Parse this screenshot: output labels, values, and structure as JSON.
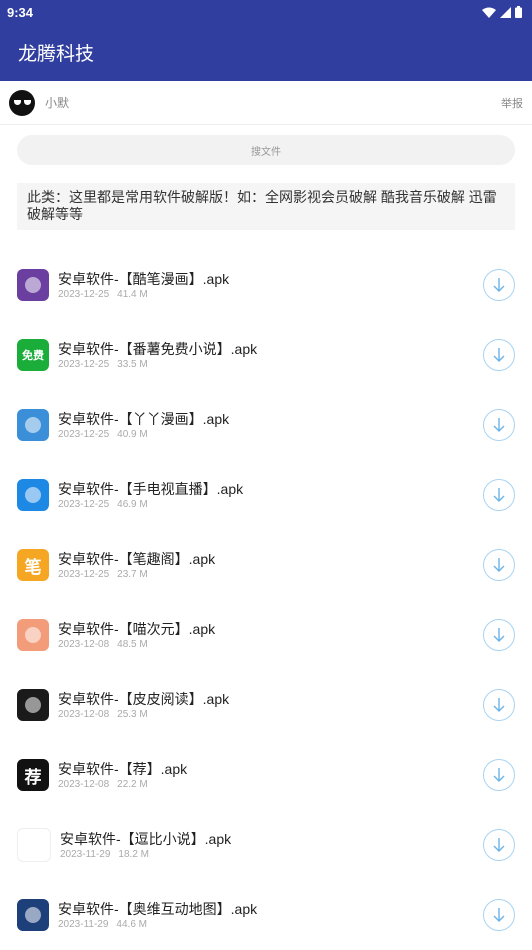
{
  "status": {
    "time": "9:34"
  },
  "app": {
    "title": "龙腾科技"
  },
  "user": {
    "name": "小默",
    "report_label": "举报"
  },
  "search": {
    "placeholder": "搜文件"
  },
  "description": "此类：这里都是常用软件破解版！如：全网影视会员破解 酷我音乐破解 迅雷破解等等",
  "colors": {
    "primary": "#303f9f",
    "download_ring": "#a9d3f2",
    "download_arrow": "#6bb4e8"
  },
  "files": [
    {
      "name": "安卓软件-【酷笔漫画】.apk",
      "date": "2023-12-25",
      "size": "41.4 M",
      "icon": "anime-girl-icon",
      "icon_color": "#6a3fa0",
      "glyph": ""
    },
    {
      "name": "安卓软件-【番薯免费小说】.apk",
      "date": "2023-12-25",
      "size": "33.5 M",
      "icon": "free-novel-icon",
      "icon_color": "#1aad3a",
      "glyph": "免费"
    },
    {
      "name": "安卓软件-【丫丫漫画】.apk",
      "date": "2023-12-25",
      "size": "40.9 M",
      "icon": "bear-book-icon",
      "icon_color": "#3b8fd8",
      "glyph": ""
    },
    {
      "name": "安卓软件-【手电视直播】.apk",
      "date": "2023-12-25",
      "size": "46.9 M",
      "icon": "tv-icon",
      "icon_color": "#1e88e5",
      "glyph": ""
    },
    {
      "name": "安卓软件-【笔趣阁】.apk",
      "date": "2023-12-25",
      "size": "23.7 M",
      "icon": "bi-character-icon",
      "icon_color": "#f5a623",
      "glyph": "笔"
    },
    {
      "name": "安卓软件-【喵次元】.apk",
      "date": "2023-12-08",
      "size": "48.5 M",
      "icon": "anime-cat-girl-icon",
      "icon_color": "#f29c7a",
      "glyph": ""
    },
    {
      "name": "安卓软件-【皮皮阅读】.apk",
      "date": "2023-12-08",
      "size": "25.3 M",
      "icon": "chat-bubble-face-icon",
      "icon_color": "#1a1a1a",
      "glyph": ""
    },
    {
      "name": "安卓软件-【荐】.apk",
      "date": "2023-12-08",
      "size": "22.2 M",
      "icon": "jian-character-icon",
      "icon_color": "#111111",
      "glyph": "荐"
    },
    {
      "name": "安卓软件-【逗比小说】.apk",
      "date": "2023-11-29",
      "size": "18.2 M",
      "icon": "cartoon-face-icon",
      "icon_color": "#ffffff",
      "glyph": ""
    },
    {
      "name": "安卓软件-【奥维互动地图】.apk",
      "date": "2023-11-29",
      "size": "44.6 M",
      "icon": "globe-map-icon",
      "icon_color": "#1d3f7a",
      "glyph": ""
    }
  ]
}
